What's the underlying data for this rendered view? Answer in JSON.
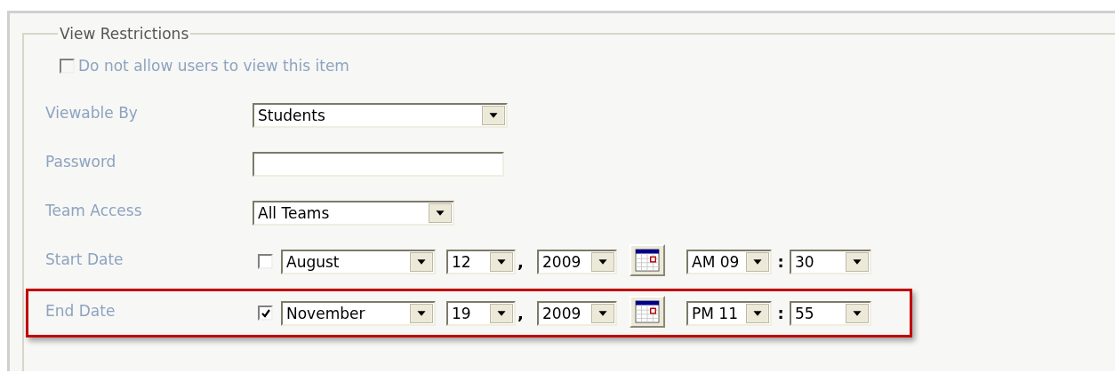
{
  "fieldset": {
    "legend": "View Restrictions"
  },
  "hide_option": {
    "label": "Do not allow users to view this item",
    "checked": false
  },
  "fields": [
    {
      "kind": "select",
      "label": "Viewable By",
      "value": "Students"
    },
    {
      "kind": "text",
      "label": "Password"
    },
    {
      "kind": "select",
      "label": "Team Access",
      "value": "All Teams"
    },
    {
      "kind": "date",
      "label": "Start Date",
      "checked": false,
      "highlighted": false,
      "month": "August",
      "day": "12",
      "separator": ",",
      "year": "2009",
      "hour": "AM 09",
      "colon": ":",
      "minute": "30"
    },
    {
      "kind": "date",
      "label": "End Date",
      "checked": true,
      "highlighted": true,
      "month": "November",
      "day": "19",
      "separator": ",",
      "year": "2009",
      "hour": "PM 11",
      "colon": ":",
      "minute": "55"
    }
  ]
}
